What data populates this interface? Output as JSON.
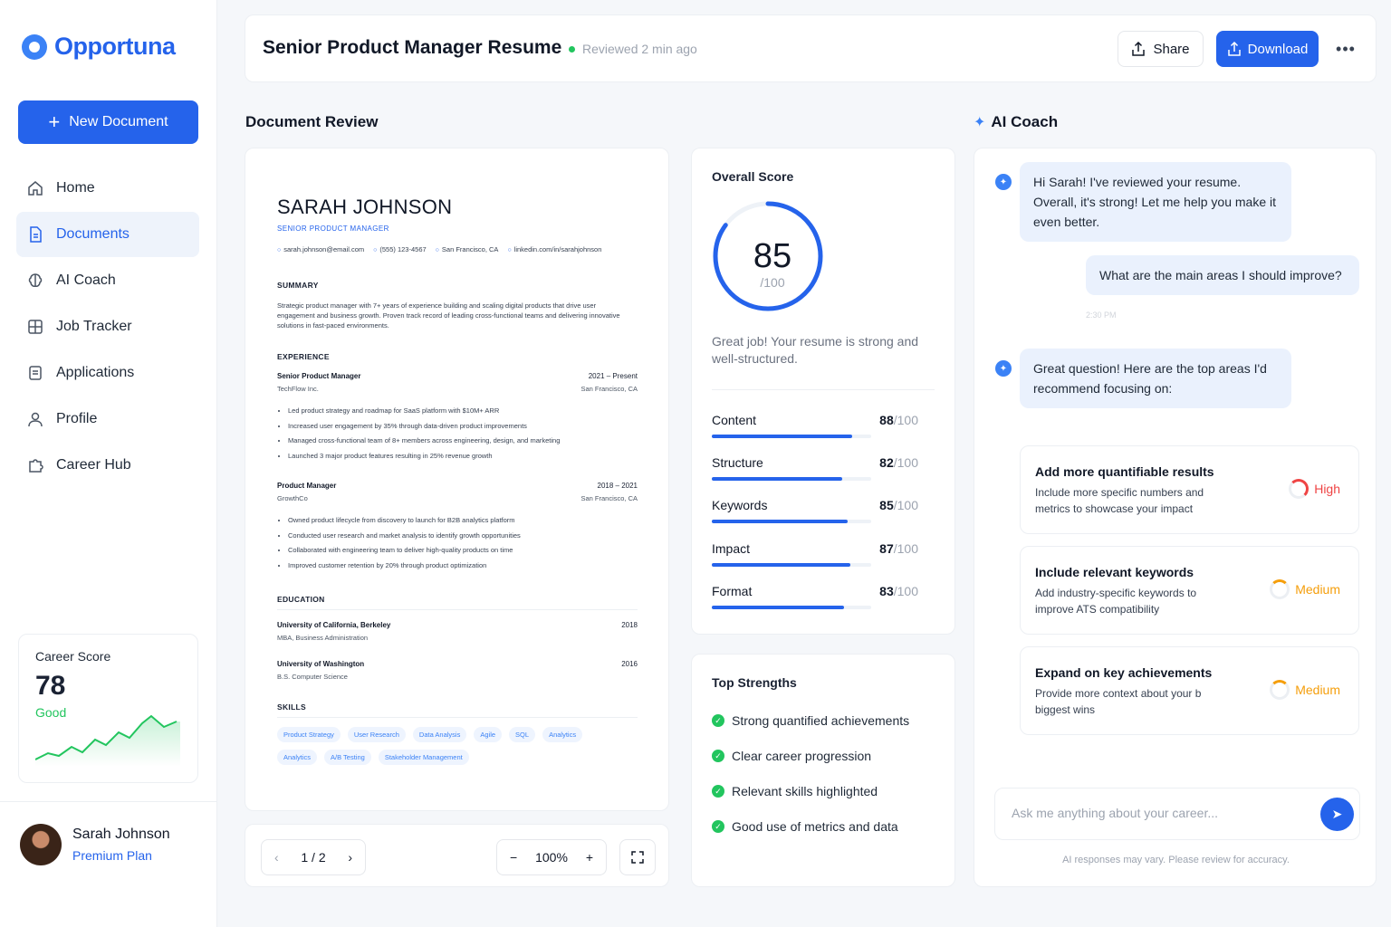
{
  "brand": {
    "name": "Opportuna"
  },
  "sidebar": {
    "new_document_label": "New Document",
    "items": [
      {
        "label": "Home",
        "icon": "home-icon"
      },
      {
        "label": "Documents",
        "icon": "document-icon",
        "active": true
      },
      {
        "label": "AI Coach",
        "icon": "brain-icon"
      },
      {
        "label": "Job Tracker",
        "icon": "board-icon"
      },
      {
        "label": "Applications",
        "icon": "clipboard-icon"
      },
      {
        "label": "Profile",
        "icon": "user-icon"
      },
      {
        "label": "Career Hub",
        "icon": "puzzle-icon"
      }
    ],
    "career_score": {
      "label": "Career Score",
      "value": "78",
      "status": "Good"
    },
    "user": {
      "name": "Sarah Johnson",
      "plan": "Premium Plan"
    }
  },
  "header": {
    "title": "Senior Product Manager Resume",
    "status": "Reviewed 2 min ago",
    "share_label": "Share",
    "download_label": "Download",
    "more_label": "•••"
  },
  "review": {
    "heading": "Document Review",
    "resume": {
      "name": "SARAH JOHNSON",
      "role": "SENIOR PRODUCT MANAGER",
      "contacts": [
        "sarah.johnson@email.com",
        "(555) 123-4567",
        "San Francisco, CA",
        "linkedin.com/in/sarahjohnson"
      ],
      "summary_heading": "SUMMARY",
      "summary": "Strategic product manager with 7+ years of experience building and scaling digital products that drive user engagement and business growth. Proven track record of leading cross-functional teams and delivering innovative solutions in fast-paced environments.",
      "experience_heading": "EXPERIENCE",
      "jobs": [
        {
          "title": "Senior Product Manager",
          "dates": "2021 – Present",
          "company": "TechFlow Inc.",
          "location": "San Francisco, CA",
          "bullets": [
            "Led product strategy and roadmap for SaaS platform with $10M+ ARR",
            "Increased user engagement by 35% through data-driven product improvements",
            "Managed cross-functional team of 8+ members across engineering, design, and marketing",
            "Launched 3 major product features resulting in 25% revenue growth"
          ]
        },
        {
          "title": "Product Manager",
          "dates": "2018 – 2021",
          "company": "GrowthCo",
          "location": "San Francisco, CA",
          "bullets": [
            "Owned product lifecycle from discovery to launch for B2B analytics platform",
            "Conducted user research and market analysis to identify growth opportunities",
            "Collaborated with engineering team to deliver high-quality products on time",
            "Improved customer retention by 20% through product optimization"
          ]
        }
      ],
      "education_heading": "EDUCATION",
      "education": [
        {
          "school": "University of California, Berkeley",
          "year": "2018",
          "degree": "MBA, Business Administration"
        },
        {
          "school": "University of Washington",
          "year": "2016",
          "degree": "B.S. Computer Science"
        }
      ],
      "skills_heading": "SKILLS",
      "skills": [
        "Product Strategy",
        "User Research",
        "Data Analysis",
        "Agile",
        "SQL",
        "Analytics",
        "Analytics",
        "A/B Testing",
        "Stakeholder Management"
      ]
    },
    "pager": {
      "page": "1 / 2",
      "zoom": "100%",
      "zoom_out": "−",
      "zoom_in": "+"
    }
  },
  "score": {
    "title": "Overall Score",
    "value": "85",
    "max": "/100",
    "percent": 85,
    "message": "Great job! Your resume is strong and well-structured.",
    "metrics": [
      {
        "name": "Content",
        "value": "88",
        "max": "/100",
        "level": 88
      },
      {
        "name": "Structure",
        "value": "82",
        "max": "/100",
        "level": 82
      },
      {
        "name": "Keywords",
        "value": "85",
        "max": "/100",
        "level": 85
      },
      {
        "name": "Impact",
        "value": "87",
        "max": "/100",
        "level": 87
      },
      {
        "name": "Format",
        "value": "83",
        "max": "/100",
        "level": 83
      }
    ]
  },
  "strengths": {
    "title": "Top Strengths",
    "items": [
      "Strong quantified achievements",
      "Clear career progression",
      "Relevant skills highlighted",
      "Good use of metrics and data"
    ]
  },
  "coach": {
    "heading": "AI Coach",
    "messages": [
      {
        "from": "bot",
        "text": "Hi Sarah! I've reviewed your resume. Overall, it's strong! Let me help you make it even better."
      },
      {
        "from": "user",
        "text": "What are the main areas I should improve?",
        "time": "2:30 PM"
      },
      {
        "from": "bot",
        "text": "Great question! Here are the top areas I'd recommend focusing on:"
      }
    ],
    "suggestions": [
      {
        "title": "Add more quantifiable results",
        "desc": "Include more specific numbers and metrics to showcase your impact",
        "priority": "High",
        "color": "#ef4444"
      },
      {
        "title": "Include relevant keywords",
        "desc": "Add industry-specific keywords to improve ATS compatibility",
        "priority": "Medium",
        "color": "#f59e0b"
      },
      {
        "title": "Expand on key achievements",
        "desc": "Provide more context about your b biggest wins",
        "priority": "Medium",
        "color": "#f59e0b"
      }
    ],
    "input_placeholder": "Ask me anything about your career...",
    "disclaimer": "AI responses may vary. Please review for accuracy."
  },
  "colors": {
    "accent": "#2563eb",
    "success": "#22c55e",
    "high": "#ef4444",
    "medium": "#f59e0b"
  }
}
